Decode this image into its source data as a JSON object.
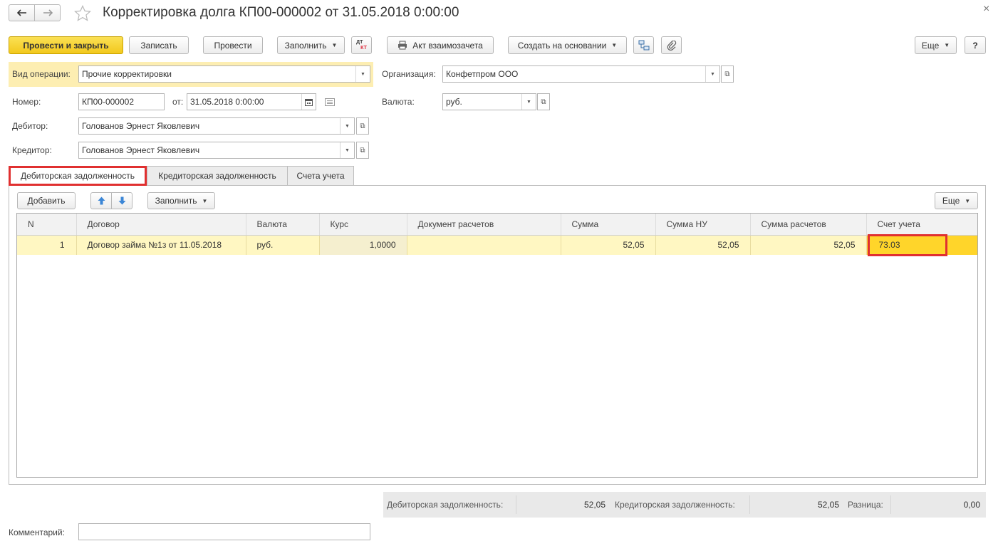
{
  "window": {
    "title": "Корректировка долга КП00-000002 от 31.05.2018 0:00:00",
    "close": "×"
  },
  "toolbar": {
    "post_and_close": "Провести и закрыть",
    "save": "Записать",
    "post": "Провести",
    "fill": "Заполнить",
    "dt_kt_top": "ДТ",
    "dt_kt_bottom": "КТ",
    "mutual_settlement_act": "Акт взаимозачета",
    "create_based_on": "Создать на основании",
    "more": "Еще",
    "help": "?"
  },
  "form": {
    "operation_type_label": "Вид операции:",
    "operation_type_value": "Прочие корректировки",
    "organization_label": "Организация:",
    "organization_value": "Конфетпром ООО",
    "number_label": "Номер:",
    "number_value": "КП00-000002",
    "date_label": "от:",
    "date_value": "31.05.2018  0:00:00",
    "currency_label": "Валюта:",
    "currency_value": "руб.",
    "debtor_label": "Дебитор:",
    "debtor_value": "Голованов Эрнест Яковлевич",
    "creditor_label": "Кредитор:",
    "creditor_value": "Голованов Эрнест Яковлевич"
  },
  "tabs": [
    {
      "label": "Дебиторская задолженность",
      "active": true
    },
    {
      "label": "Кредиторская задолженность",
      "active": false
    },
    {
      "label": "Счета учета",
      "active": false
    }
  ],
  "table_toolbar": {
    "add": "Добавить",
    "fill": "Заполнить",
    "more": "Еще"
  },
  "table": {
    "columns": [
      "N",
      "Договор",
      "Валюта",
      "Курс",
      "Документ расчетов",
      "Сумма",
      "Сумма НУ",
      "Сумма расчетов",
      "Счет учета"
    ],
    "rows": [
      [
        "1",
        "Договор займа №1з от 11.05.2018",
        "руб.",
        "1,0000",
        "",
        "52,05",
        "52,05",
        "52,05",
        "73.03"
      ]
    ]
  },
  "totals": {
    "receivable_label": "Дебиторская задолженность:",
    "receivable_value": "52,05",
    "payable_label": "Кредиторская задолженность:",
    "payable_value": "52,05",
    "difference_label": "Разница:",
    "difference_value": "0,00"
  },
  "comment": {
    "label": "Комментарий:",
    "value": ""
  },
  "colors": {
    "primary_button": "#f4cb23",
    "highlight_row": "#fff7c2",
    "selected_cell": "#ffd52a",
    "annotation_red": "#e03030"
  }
}
